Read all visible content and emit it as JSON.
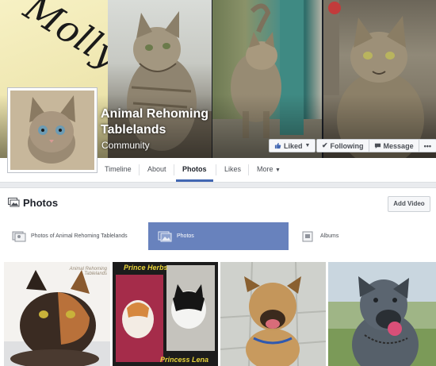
{
  "cover": {
    "molly_text": "Molly",
    "page_name": "Animal Rehoming Tablelands",
    "category": "Community"
  },
  "actions": {
    "liked": "Liked",
    "following": "Following",
    "message": "Message",
    "more": "•••"
  },
  "nav": {
    "items": [
      "Timeline",
      "About",
      "Photos",
      "Likes",
      "More"
    ],
    "active": "Photos"
  },
  "photos": {
    "title": "Photos",
    "add_video": "Add Video",
    "tabs": [
      "Photos of Animal Rehoming Tablelands",
      "Photos",
      "Albums"
    ],
    "active_tab": "Photos",
    "thumb_texts": {
      "prince": "Prince Herbs",
      "princess": "Princess Lena",
      "rehoming": "Animal Rehoming Tablelands"
    }
  },
  "colors": {
    "accent": "#4267b2",
    "tab_active": "#6882bd",
    "page_bg": "#e9ebee"
  }
}
